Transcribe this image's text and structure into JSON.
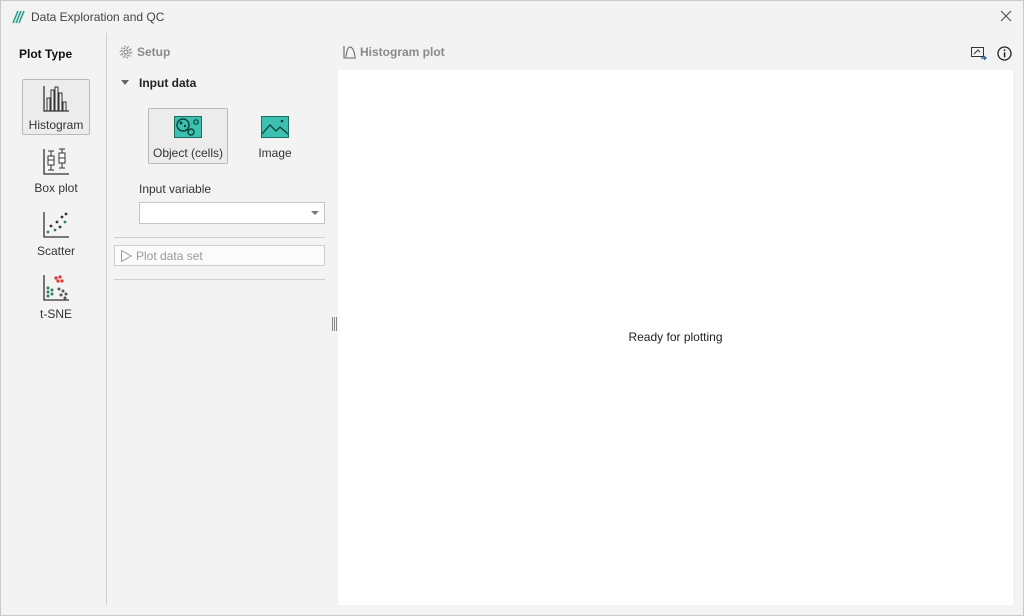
{
  "window": {
    "title": "Data Exploration and QC",
    "icons": {
      "app": "app-logo-icon",
      "close": "close-icon"
    }
  },
  "plot_type": {
    "heading": "Plot Type",
    "items": [
      {
        "label": "Histogram",
        "icon": "histogram-icon",
        "selected": true
      },
      {
        "label": "Box plot",
        "icon": "box-plot-icon",
        "selected": false
      },
      {
        "label": "Scatter",
        "icon": "scatter-icon",
        "selected": false
      },
      {
        "label": "t-SNE",
        "icon": "tsne-icon",
        "selected": false
      }
    ]
  },
  "setup": {
    "title": "Setup",
    "icon": "gear-icon",
    "input_data": {
      "label": "Input data",
      "expanded": true,
      "options": [
        {
          "label": "Object (cells)",
          "icon": "object-cells-icon",
          "selected": true
        },
        {
          "label": "Image",
          "icon": "image-icon",
          "selected": false
        }
      ]
    },
    "input_variable": {
      "label": "Input variable",
      "value": ""
    },
    "plot_button": {
      "label": "Plot data set",
      "enabled": false
    }
  },
  "plot": {
    "title": "Histogram plot",
    "icon": "histogram-plot-icon",
    "status": "Ready for plotting",
    "actions": [
      {
        "name": "export-icon"
      },
      {
        "name": "info-icon"
      }
    ]
  },
  "colors": {
    "accent": "#2a9d8f",
    "teal_fill": "#3cc0b0",
    "red_dot": "#e03131",
    "green_dot": "#2f7d5a"
  }
}
